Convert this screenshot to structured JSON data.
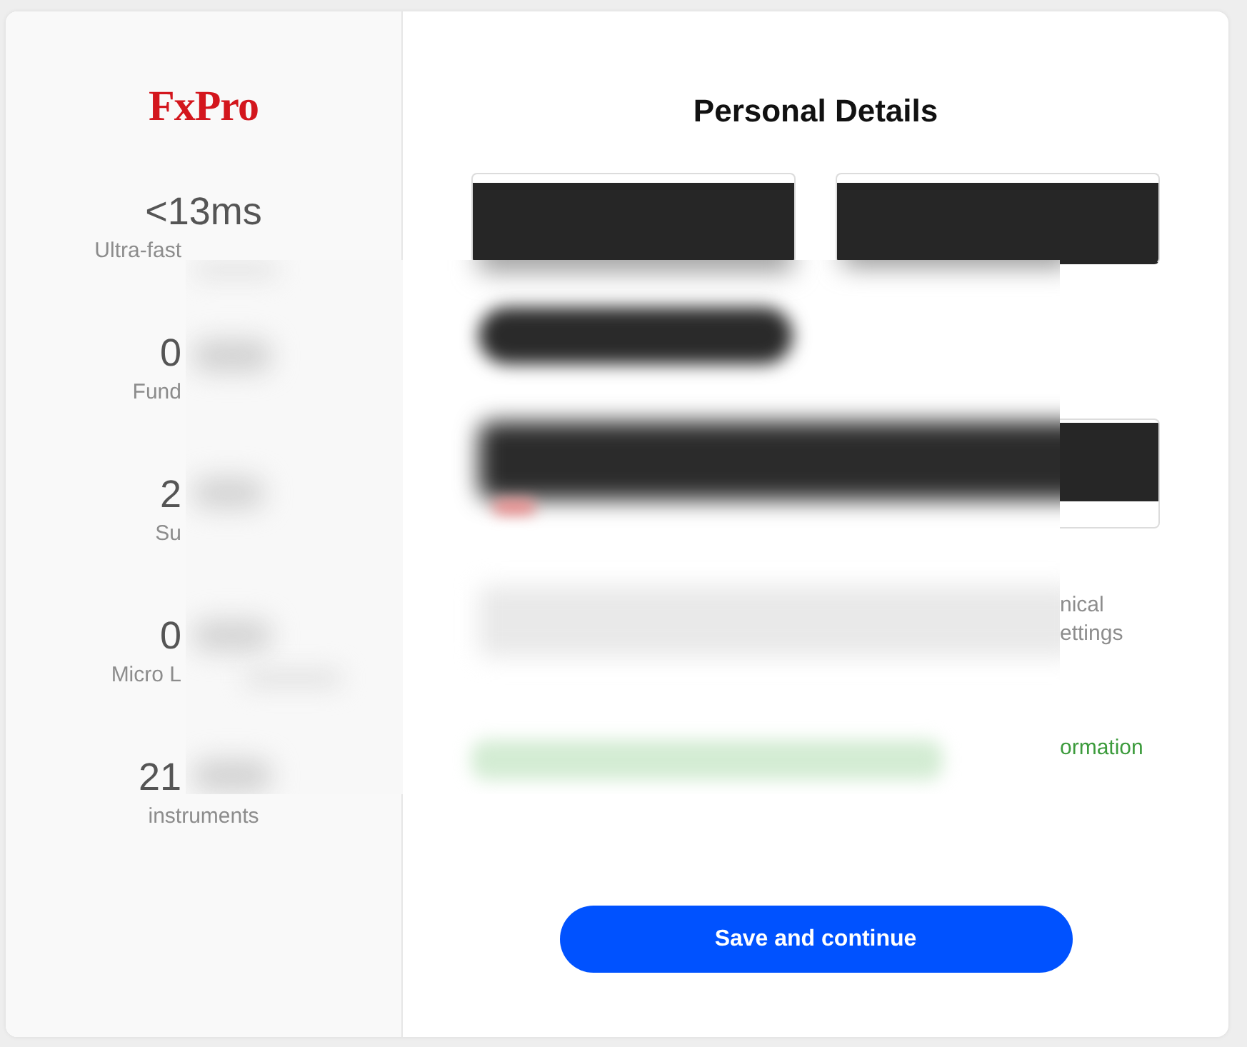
{
  "sidebar": {
    "logo": "FxPro",
    "stats": [
      {
        "value": "<13ms",
        "label": "Ultra-fast"
      },
      {
        "value": "0",
        "label": "Fund"
      },
      {
        "value": "2",
        "label": "Su"
      },
      {
        "value": "0",
        "label": "Micro L"
      },
      {
        "value": "21",
        "label": "instruments"
      }
    ]
  },
  "form": {
    "title": "Personal Details",
    "fields": [
      {
        "redacted": true
      },
      {
        "redacted": true
      },
      {
        "redacted": true
      }
    ],
    "notice_lines": [
      "nical",
      "ettings"
    ],
    "status_text": "ormation",
    "button": "Save and continue"
  }
}
